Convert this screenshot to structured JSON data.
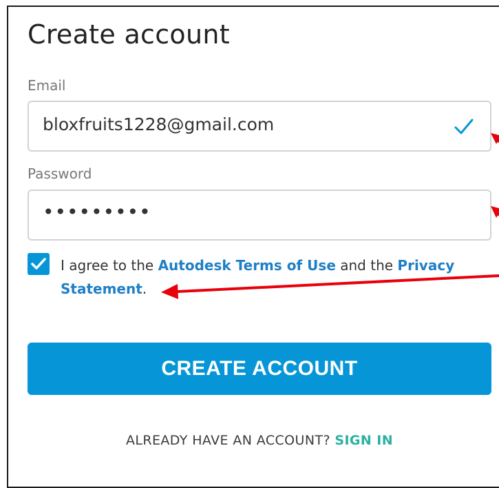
{
  "form": {
    "title": "Create account",
    "email": {
      "label": "Email",
      "value": "bloxfruits1228@gmail.com",
      "valid_icon": "checkmark-icon"
    },
    "password": {
      "label": "Password",
      "masked_value": "•••••••••"
    },
    "agree": {
      "checked": true,
      "prefix": "I agree to the ",
      "terms_link": "Autodesk Terms of Use",
      "middle": " and the ",
      "privacy_link": "Privacy Statement",
      "suffix": "."
    },
    "create_button_label": "CREATE ACCOUNT",
    "signin_prompt": "ALREADY HAVE AN ACCOUNT? ",
    "signin_link": "SIGN IN"
  },
  "colors": {
    "accent_blue": "#0696d7",
    "link_blue": "#1f7fc5",
    "signin_teal": "#2bb1a2",
    "annotation_red": "#e8000b"
  }
}
